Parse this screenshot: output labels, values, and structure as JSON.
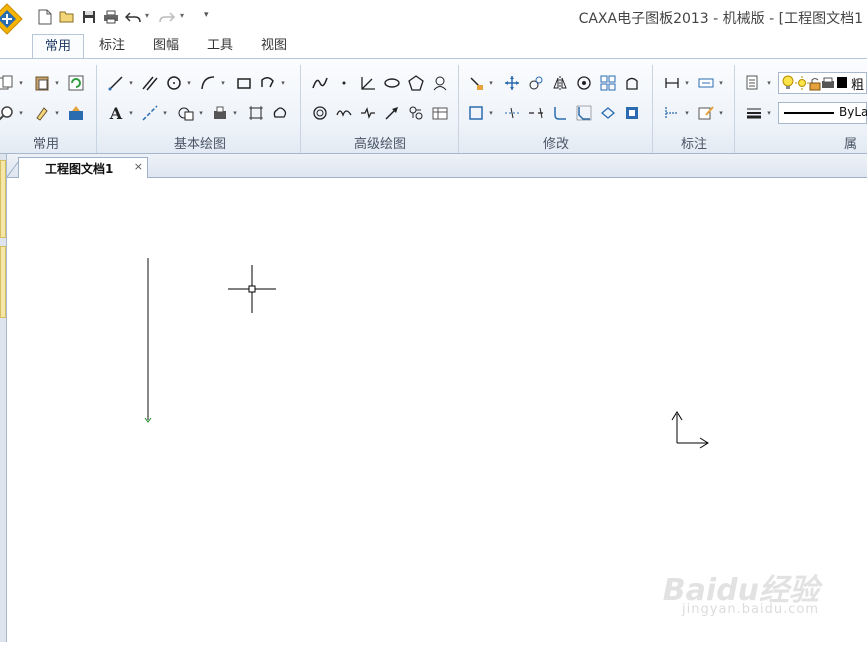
{
  "window": {
    "title": "CAXA电子图板2013 - 机械版 - [工程图文档1"
  },
  "quick_access": [
    "new-file-icon",
    "open-folder-icon",
    "save-icon",
    "print-icon",
    "undo-icon",
    "redo-icon",
    "customize-icon"
  ],
  "ribbon_tabs": [
    {
      "label": "常用",
      "active": true
    },
    {
      "label": "标注",
      "active": false
    },
    {
      "label": "图幅",
      "active": false
    },
    {
      "label": "工具",
      "active": false
    },
    {
      "label": "视图",
      "active": false
    }
  ],
  "ribbon_groups": {
    "common": "常用",
    "basic_draw": "基本绘图",
    "advanced_draw": "高级绘图",
    "modify": "修改",
    "annotate": "标注",
    "properties": "属"
  },
  "properties": {
    "layer_label": "粗",
    "line_type": "ByLay"
  },
  "document_tab": {
    "label": "工程图文档1",
    "close": "×"
  },
  "watermark": {
    "brand": "Baidu经验",
    "url": "jingyan.baidu.com"
  },
  "colors": {
    "accent": "#1d3a63",
    "ribbon_bg": "#eef3f9",
    "canvas": "#ffffff",
    "icon_blue": "#2b6cb0",
    "icon_orange": "#e6a23c",
    "icon_green": "#2f9d3f"
  }
}
